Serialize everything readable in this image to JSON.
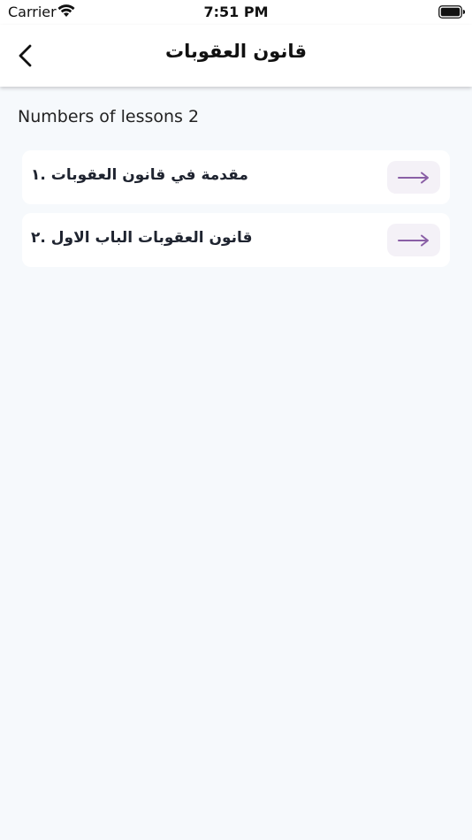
{
  "status_bar": {
    "carrier": "Carrier",
    "time": "7:51 PM"
  },
  "nav": {
    "title": "قانون العقوبات",
    "back_icon": "chevron-left-icon"
  },
  "lessons": {
    "count_label": "Numbers of lessons 2",
    "items": [
      {
        "title": "مقدمة في قانون العقوبات .١",
        "icon": "arrow-right-icon"
      },
      {
        "title": "قانون العقوبات الباب الاول .٢",
        "icon": "arrow-right-icon"
      }
    ]
  },
  "colors": {
    "background": "#f6f9fc",
    "card": "#ffffff",
    "accent": "#8a5fa6",
    "arrow_button_bg": "#f4f1f7"
  }
}
